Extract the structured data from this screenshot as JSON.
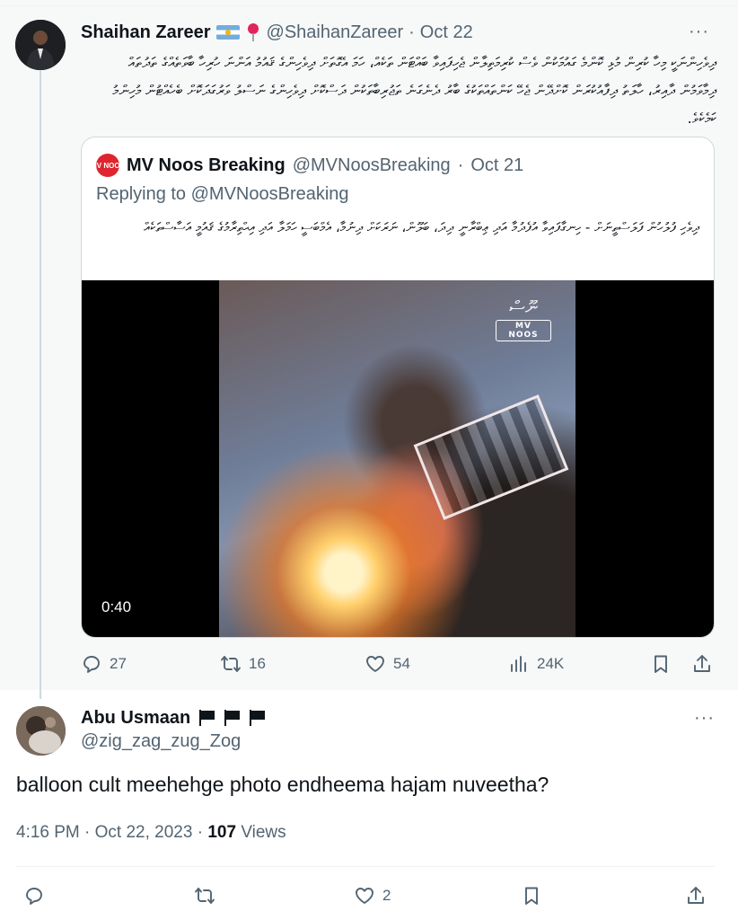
{
  "parent_tweet": {
    "display_name": "Shaihan Zareer",
    "handle": "@ShaihanZareer",
    "date": "Oct 22",
    "body": "ދިވެހިންނަކީ މިހާ ކުރިން މުޅި ކޮންމެ ގައުމަކުން ވެސް ކުރިމަތިލާން ޖެހިފައިވާ ބައްޓަން ތަކެއް، ހަމަ އެގޮތަށް ދިވެހިންގެ ޤައުމު އަންނަ ހުރިހާ ބާވަތެއްގެ ތަދުތައް ދިމާވަމުން ދާއިރު، ހާލަތު ދިފާއުކުރަން ކޮށްދޭން ޖެހޭ ކަންތައްތަކުގެ ބާރު ދެނެގަނެ ތަޖުރިބާތަކުން ދަސްކޮށް ދިވެހިންގެ ނަސްލު ވަރުގަދަކޮށް ބެހެއްޓުން މުހިންމު ކަމެކެވެ.",
    "stats": {
      "replies": "27",
      "reposts": "16",
      "likes": "54",
      "views": "24K"
    }
  },
  "quoted_tweet": {
    "avatar_text": "MV NOOS",
    "display_name": "MV Noos Breaking",
    "handle": "@MVNoosBreaking",
    "date": "Oct 21",
    "replying_to": "Replying to @MVNoosBreaking",
    "body": "ދިވެހި ފުލުހުން ފަލަސްތީނަށް - ހިނގާފައިވާ އުފެދުމާ އަދި ޢިބްރާނީ ދިދަ، ބަލޫން، ނަރަކަށް ދިނުމާ، އެމްބަސީ ހަމަލާ އަދި އިޙްތިރާމުގެ ޤައުމީ އަސާސްތަކެއް",
    "video": {
      "watermark_logo": "ނޫސް",
      "watermark_label": "MV NOOS",
      "duration": "0:40"
    }
  },
  "reply_tweet": {
    "display_name": "Abu Usmaan",
    "handle": "@zig_zag_zug_Zog",
    "body": "balloon cult meehehge photo endheema hajam nuveetha?",
    "timestamp": "4:16 PM · Oct 22, 2023 · ",
    "views_count": "107",
    "views_label": "Views",
    "stats": {
      "replies": "",
      "reposts": "",
      "likes": "2"
    }
  },
  "ui": {
    "more_glyph": "···"
  }
}
